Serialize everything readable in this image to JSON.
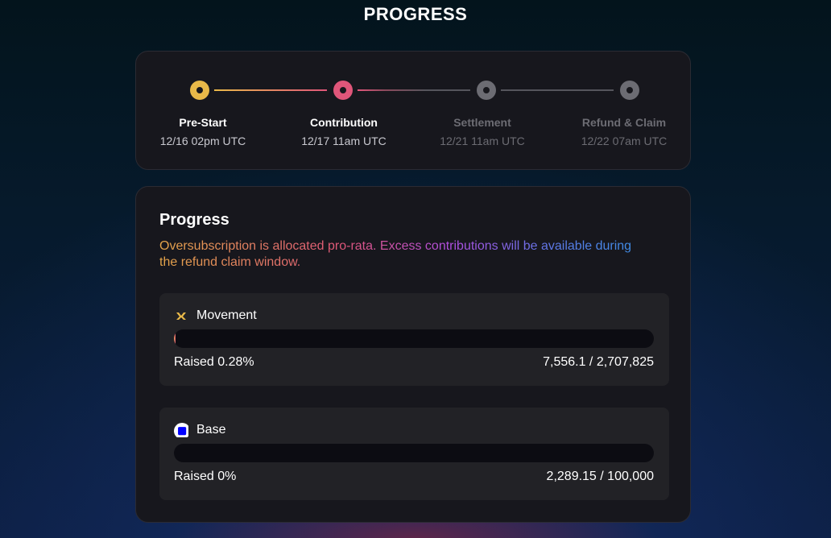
{
  "page": {
    "title": "PROGRESS"
  },
  "timeline": {
    "steps": [
      {
        "label": "Pre-Start",
        "date": "12/16 02pm UTC",
        "state": "active",
        "color": "#e9b949"
      },
      {
        "label": "Contribution",
        "date": "12/17 11am UTC",
        "state": "active",
        "color": "#e0567a"
      },
      {
        "label": "Settlement",
        "date": "12/21 11am UTC",
        "state": "inactive",
        "color": "#6c6c73"
      },
      {
        "label": "Refund & Claim",
        "date": "12/22 07am UTC",
        "state": "inactive",
        "color": "#6c6c73"
      }
    ]
  },
  "progress": {
    "title": "Progress",
    "description": "Oversubscription is allocated pro-rata. Excess contributions will be available during the refund claim window.",
    "tokens": [
      {
        "name": "Movement",
        "icon": "movement-logo-icon",
        "raised": "Raised 0.28%",
        "raised_fraction": 0.0028,
        "amount": "7,556.1 / 2,707,825"
      },
      {
        "name": "Base",
        "icon": "base-logo-icon",
        "raised": "Raised 0%",
        "raised_fraction": 0,
        "amount": "2,289.15 / 100,000"
      }
    ]
  },
  "colors": {
    "accent_yellow": "#e9b949",
    "accent_pink": "#e0567a",
    "base_blue": "#0000ff",
    "card_bg": "#17171d",
    "inactive": "#6c6c73"
  }
}
